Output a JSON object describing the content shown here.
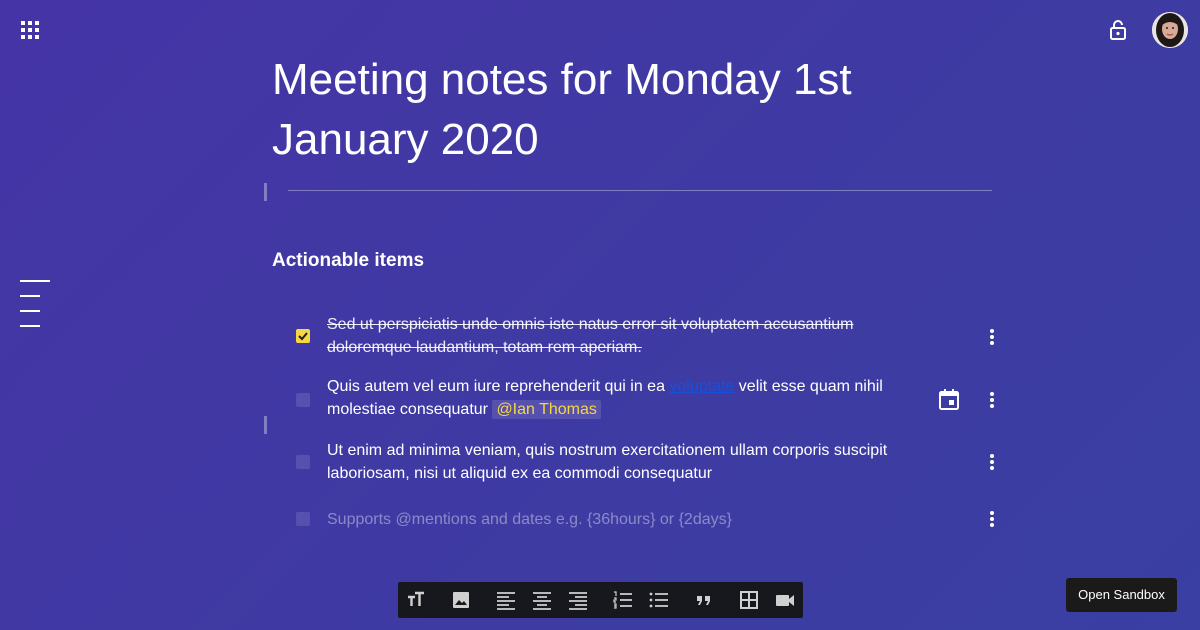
{
  "header": {
    "apps_icon": "apps-grid-icon",
    "lock_icon": "lock-open-icon",
    "avatar": "user-avatar"
  },
  "document": {
    "title": "Meeting notes for Monday 1st January 2020",
    "section_heading": "Actionable items"
  },
  "tasks": [
    {
      "checked": true,
      "text": "Sed ut perspiciatis unde omnis iste natus error sit voluptatem accusantium doloremque laudantium, totam rem aperiam."
    },
    {
      "checked": false,
      "text_before": "Quis autem vel eum iure reprehenderit qui in ea ",
      "link": "voluptate",
      "text_after": " velit esse quam nihil molestiae consequatur ",
      "mention": "@Ian Thomas",
      "has_date_icon": true
    },
    {
      "checked": false,
      "text": "Ut enim ad minima veniam, quis nostrum exercitationem ullam corporis suscipit laboriosam, nisi ut aliquid ex ea commodi consequatur"
    },
    {
      "checked": false,
      "placeholder": "Supports @mentions and dates e.g. {36hours} or {2days}"
    }
  ],
  "toolbar": {
    "buttons": [
      "text-size-icon",
      "image-icon",
      "align-left-icon",
      "align-center-icon",
      "align-right-icon",
      "numbered-list-icon",
      "bulleted-list-icon",
      "quote-icon",
      "table-icon",
      "video-icon"
    ]
  },
  "sandbox_button": "Open Sandbox",
  "colors": {
    "background": "#4034a5",
    "accent": "#f5d742",
    "link": "#1a4fd8",
    "toolbar": "#17181e"
  }
}
